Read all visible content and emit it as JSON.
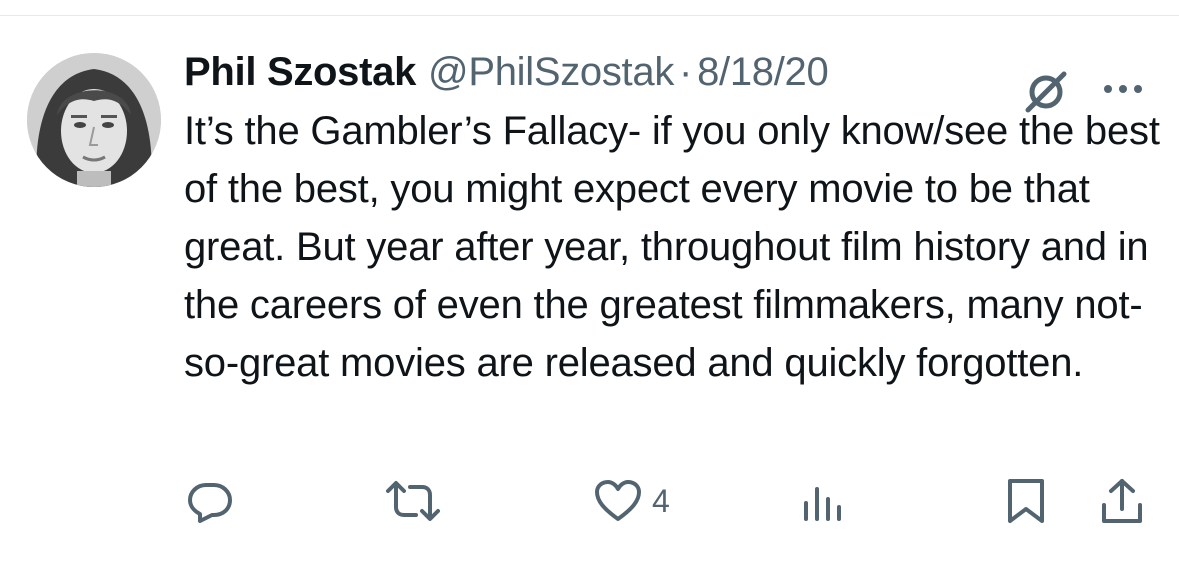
{
  "tweet": {
    "author": {
      "name": "Phil Szostak",
      "handle": "@PhilSzostak",
      "avatar": "avatar-photo"
    },
    "separator": "·",
    "date": "8/18/20",
    "text": "It’s the Gambler’s Fallacy- if you only know/see the best of the best, you might expect every movie to be that great. But year after year, throughout film history and in the careers of even the greatest filmmakers, many not-so-great movies are released and quickly forgotten.",
    "header_icons": [
      "grok-icon",
      "more-icon"
    ],
    "actions": {
      "reply": {
        "icon": "reply-icon",
        "count": ""
      },
      "retweet": {
        "icon": "retweet-icon",
        "count": ""
      },
      "like": {
        "icon": "heart-icon",
        "count": "4"
      },
      "views": {
        "icon": "views-icon",
        "count": ""
      },
      "bookmark": {
        "icon": "bookmark-icon"
      },
      "share": {
        "icon": "share-icon"
      }
    }
  },
  "colors": {
    "text_primary": "#0f1419",
    "text_secondary": "#536471",
    "divider": "#e7e9ea",
    "background": "#ffffff"
  }
}
